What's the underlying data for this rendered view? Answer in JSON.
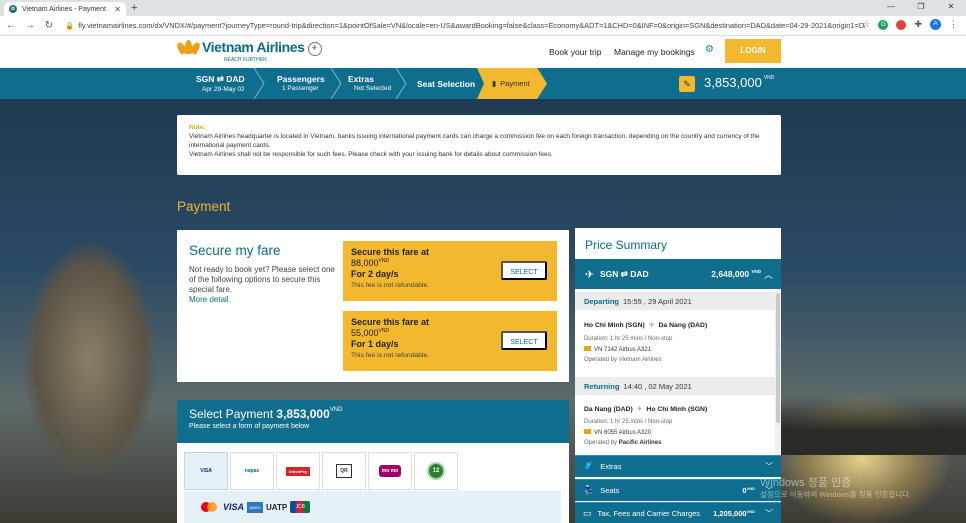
{
  "browser": {
    "tab_title": "Vietnam Airlines - Payment",
    "url": "fly.vietnamairlines.com/dx/VNDX/#/payment?journeyType=round-trip&direction=1&pointOfSale=VN&locale=en-US&awardBooking=false&class=Economy&ADT=1&CHD=0&INF=0&origin=SGN&destination=DAD&date=04-29-2021&origin1=DAD&..."
  },
  "header": {
    "brand": "Vietnam Airlines",
    "tagline": "REACH FURTHER",
    "nav": [
      "Book your trip",
      "Manage my bookings"
    ],
    "login_label": "LOGIN"
  },
  "steps": [
    {
      "title": "SGN ⇄ DAD",
      "sub": "Apr 29-May 02"
    },
    {
      "title": "Passengers",
      "sub": "1 Passenger"
    },
    {
      "title": "Extras",
      "sub": "Not Selected"
    },
    {
      "title": "Seat Selection",
      "sub": ""
    },
    {
      "title": "Payment",
      "sub": ""
    }
  ],
  "total": {
    "amount": "3,853,000",
    "currency": "VND"
  },
  "note": {
    "title": "Note:",
    "line1": "Vietnam Airlines headquarter is located in Vietnam, banks issuing international payment cards can charge a commission fee on each foreign transaction, depending on the country and currency of the international payment cards.",
    "line2": "Vietnam Airlines shall not be responsible for such fees. Please check with your issuing bank for details about commission fees."
  },
  "payment_heading": "Payment",
  "secure": {
    "title": "Secure my fare",
    "desc": "Not ready to book yet? Please select one of the following options to secure this special fare.",
    "more": "More detail.",
    "options": [
      {
        "label": "Secure this fare at",
        "amount": "88,000",
        "currency": "VND",
        "duration": "For 2 day/s",
        "note": "This fee is not refundable.",
        "button": "SELECT"
      },
      {
        "label": "Secure this fare at",
        "amount": "55,000",
        "currency": "VND",
        "duration": "For 1 day/s",
        "note": "This fee is not refundable.",
        "button": "SELECT"
      }
    ]
  },
  "select_payment": {
    "title": "Select Payment",
    "amount": "3,853,000",
    "currency": "VND",
    "subtitle": "Please select a form of payment below",
    "methods": [
      {
        "name": "international-cards",
        "text": "VISA"
      },
      {
        "name": "napas",
        "text": "napas"
      },
      {
        "name": "union-pay",
        "text": "UnionPay"
      },
      {
        "name": "qr-pay",
        "text": "QR"
      },
      {
        "name": "momo",
        "text": "mo mo"
      },
      {
        "name": "payoo",
        "text": "12"
      }
    ],
    "card_labels": [
      "VISA",
      "UATP",
      "JCB"
    ]
  },
  "price_summary": {
    "title": "Price Summary",
    "route": "SGN ⇄ DAD",
    "route_amount": "2,648,000",
    "currency": "VND",
    "segments": [
      {
        "label": "Departing",
        "when": "15:55 , 29 April 2021",
        "from": "Ho Chi Minh (SGN)",
        "to": "Da Nang (DAD)",
        "duration": "Duration: 1 hr 25 mins / Non-stop",
        "flight": "VN 7142 Airbus A321",
        "operated_prefix": "Operated by",
        "operated_by": "Vietnam Airlines"
      },
      {
        "label": "Returning",
        "when": "14:40 , 02 May 2021",
        "from": "Da Nang (DAD)",
        "to": "Ho Chi Minh (SGN)",
        "duration": "Duration: 1 hr 25 mins / Non-stop",
        "flight": "VN 6055 Airbus A320",
        "operated_prefix": "Operated by",
        "operated_by": "Pacific Airlines"
      }
    ],
    "extras_label": "Extras",
    "seats_label": "Seats",
    "seats_amount": "0",
    "tax_label": "Tax, Fees and Carrier Charges",
    "tax_amount": "1,205,000"
  },
  "watermark": {
    "line1": "Windows 정품 인증",
    "line2": "설정으로 이동하여 Windows를 정품 인증합니다."
  },
  "colors": {
    "brand_teal": "#0f6d8e",
    "accent_gold": "#f2b82e"
  }
}
